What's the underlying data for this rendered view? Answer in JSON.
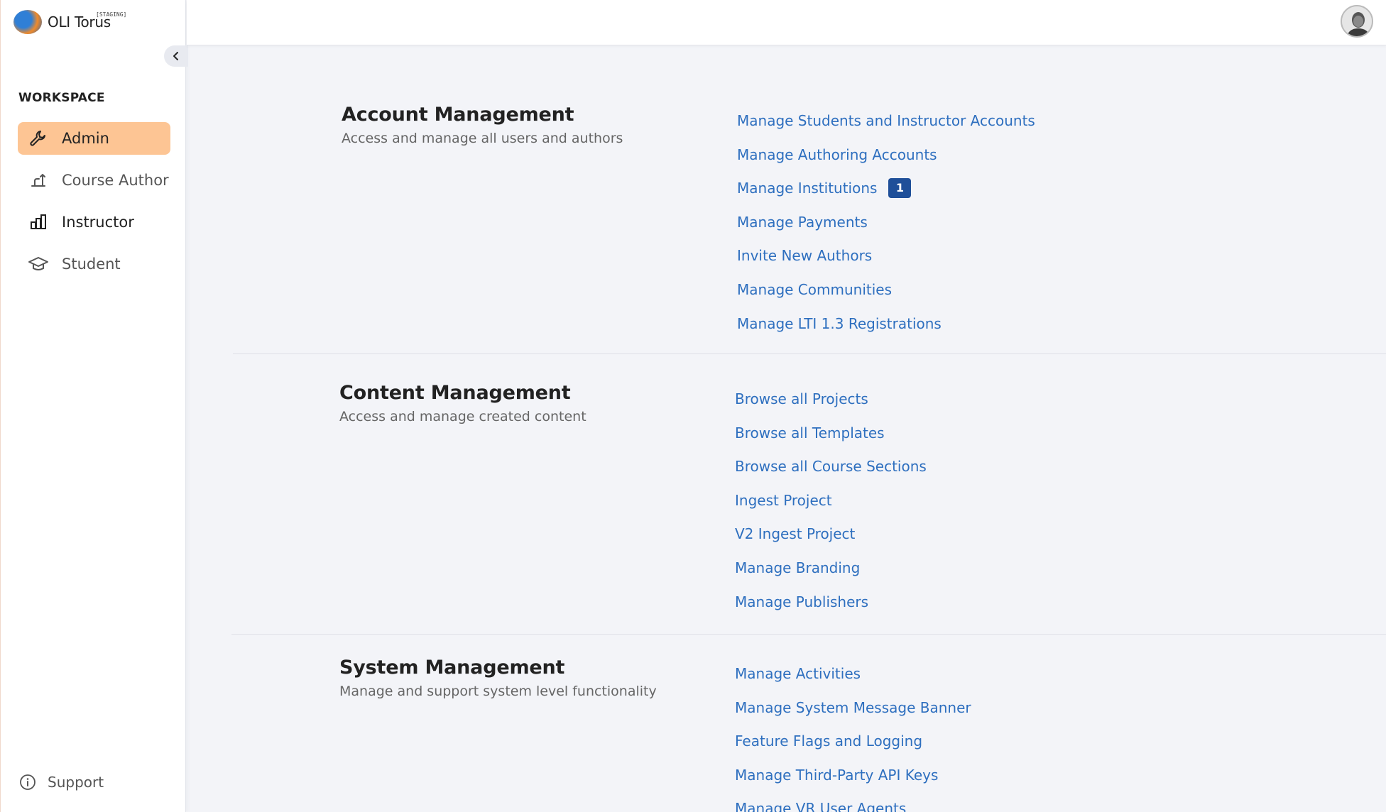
{
  "app": {
    "name": "OLI Torus",
    "env_badge": "[STAGING]"
  },
  "sidebar": {
    "workspace_title": "WORKSPACE",
    "items": [
      {
        "label": "Admin",
        "icon": "wrench-icon",
        "active": true
      },
      {
        "label": "Course Author",
        "icon": "author-icon",
        "active": false
      },
      {
        "label": "Instructor",
        "icon": "bar-chart-icon",
        "active": false
      },
      {
        "label": "Student",
        "icon": "graduation-cap-icon",
        "active": false
      }
    ],
    "support_label": "Support"
  },
  "sections": [
    {
      "title": "Account Management",
      "description": "Access and manage all users and authors",
      "links": [
        {
          "label": "Manage Students and Instructor Accounts"
        },
        {
          "label": "Manage Authoring Accounts"
        },
        {
          "label": "Manage Institutions",
          "badge": "1"
        },
        {
          "label": "Manage Payments"
        },
        {
          "label": "Invite New Authors"
        },
        {
          "label": "Manage Communities"
        },
        {
          "label": "Manage LTI 1.3 Registrations"
        }
      ]
    },
    {
      "title": "Content Management",
      "description": "Access and manage created content",
      "links": [
        {
          "label": "Browse all Projects"
        },
        {
          "label": "Browse all Templates"
        },
        {
          "label": "Browse all Course Sections"
        },
        {
          "label": "Ingest Project"
        },
        {
          "label": "V2 Ingest Project"
        },
        {
          "label": "Manage Branding"
        },
        {
          "label": "Manage Publishers"
        }
      ]
    },
    {
      "title": "System Management",
      "description": "Manage and support system level functionality",
      "links": [
        {
          "label": "Manage Activities"
        },
        {
          "label": "Manage System Message Banner"
        },
        {
          "label": "Feature Flags and Logging"
        },
        {
          "label": "Manage Third-Party API Keys"
        },
        {
          "label": "Manage VR User Agents"
        }
      ]
    }
  ],
  "colors": {
    "accent_active": "#fdc594",
    "link": "#2e6fbf",
    "badge": "#1f4f99",
    "background": "#f3f4f8"
  }
}
